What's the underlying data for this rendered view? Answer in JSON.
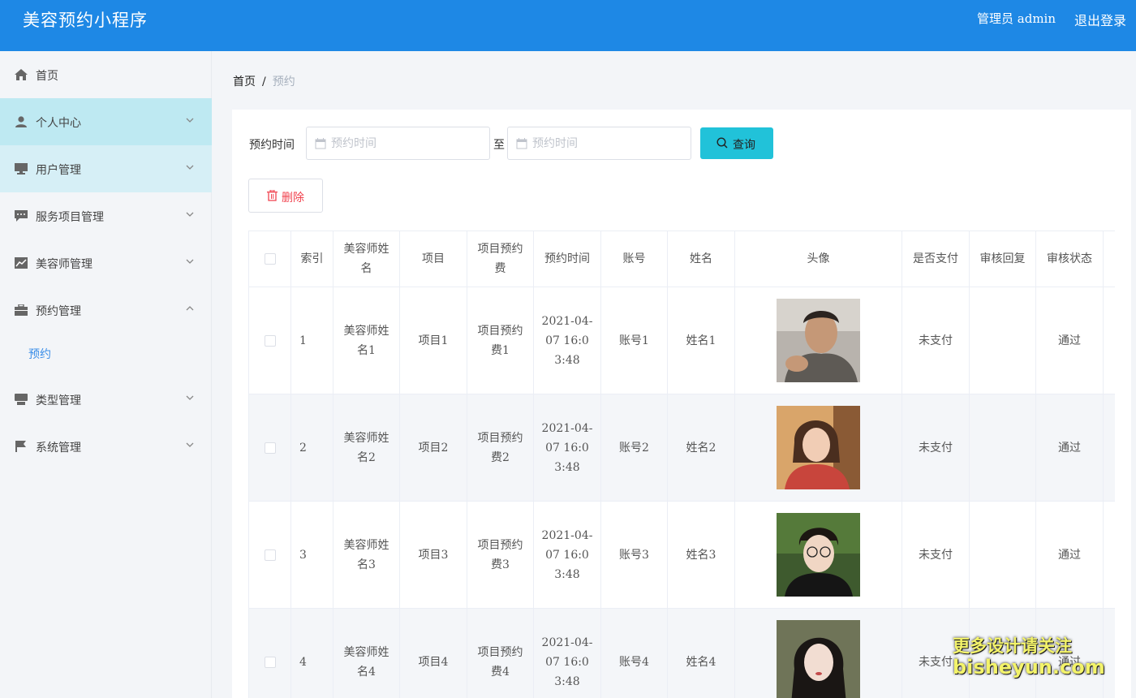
{
  "header": {
    "title": "美容预约小程序",
    "admin_text": "管理员 admin",
    "logout_label": "退出登录"
  },
  "sidebar": {
    "items": [
      {
        "label": "首页",
        "icon": "home-icon"
      },
      {
        "label": "个人中心",
        "icon": "user-icon"
      },
      {
        "label": "用户管理",
        "icon": "monitor-icon"
      },
      {
        "label": "服务项目管理",
        "icon": "chat-icon"
      },
      {
        "label": "美容师管理",
        "icon": "chart-icon"
      },
      {
        "label": "预约管理",
        "icon": "briefcase-icon"
      },
      {
        "label": "类型管理",
        "icon": "printer-icon"
      },
      {
        "label": "系统管理",
        "icon": "flag-icon"
      }
    ],
    "submenu": {
      "label": "预约"
    }
  },
  "breadcrumb": {
    "home": "首页",
    "separator": "/",
    "current": "预约"
  },
  "search": {
    "label": "预约时间",
    "start_placeholder": "预约时间",
    "to_label": "至",
    "end_placeholder": "预约时间",
    "button_label": "查询"
  },
  "actions": {
    "delete_label": "删除"
  },
  "table": {
    "columns": [
      "索引",
      "美容师姓名",
      "项目",
      "项目预约费",
      "预约时间",
      "账号",
      "姓名",
      "头像",
      "是否支付",
      "审核回复",
      "审核状态"
    ],
    "rows": [
      {
        "index": "1",
        "beautician": "美容师姓名1",
        "project": "项目1",
        "fee": "项目预约费1",
        "time": "2021-04-07 16:03:48",
        "account": "账号1",
        "name": "姓名1",
        "paid": "未支付",
        "reply": "",
        "status": "通过"
      },
      {
        "index": "2",
        "beautician": "美容师姓名2",
        "project": "项目2",
        "fee": "项目预约费2",
        "time": "2021-04-07 16:03:48",
        "account": "账号2",
        "name": "姓名2",
        "paid": "未支付",
        "reply": "",
        "status": "通过"
      },
      {
        "index": "3",
        "beautician": "美容师姓名3",
        "project": "项目3",
        "fee": "项目预约费3",
        "time": "2021-04-07 16:03:48",
        "account": "账号3",
        "name": "姓名3",
        "paid": "未支付",
        "reply": "",
        "status": "通过"
      },
      {
        "index": "4",
        "beautician": "美容师姓名4",
        "project": "项目4",
        "fee": "项目预约费4",
        "time": "2021-04-07 16:03:48",
        "account": "账号4",
        "name": "姓名4",
        "paid": "未支付",
        "reply": "",
        "status": "通过"
      }
    ]
  },
  "watermark": {
    "line1": "更多设计请关注",
    "line2": "bisheyun.com"
  },
  "colors": {
    "header_bg": "#1e88e5",
    "accent_cyan": "#21c2d9",
    "danger": "#f0414d",
    "menu_active": "#bee9f2"
  }
}
